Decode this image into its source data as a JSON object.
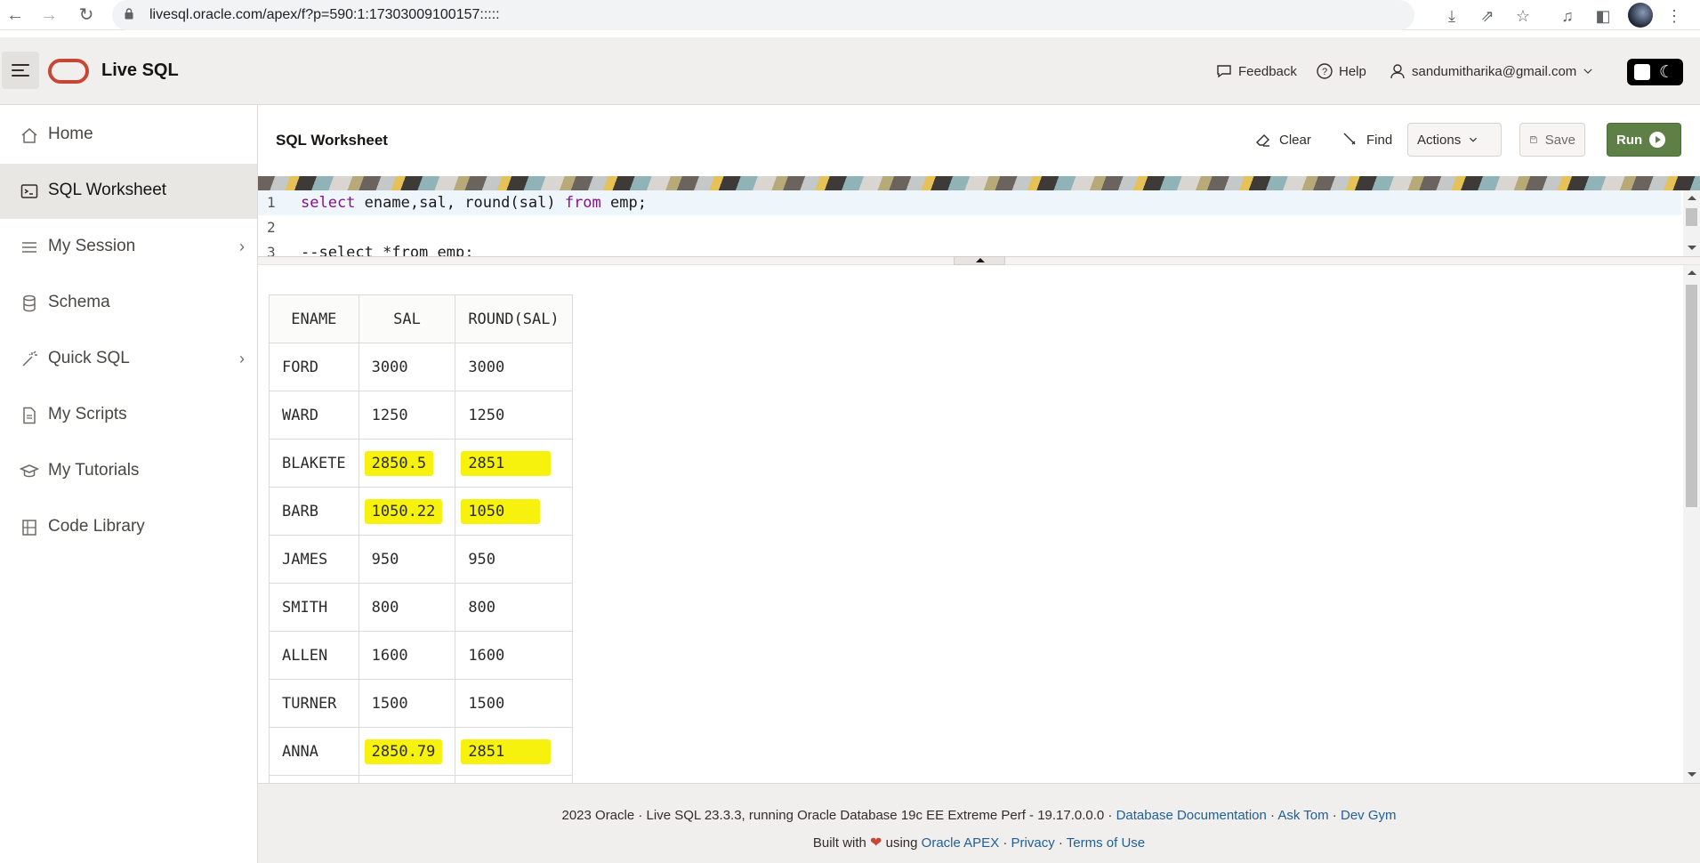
{
  "browser": {
    "url": "livesql.oracle.com/apex/f?p=590:1:17303009100157:::::"
  },
  "header": {
    "app_title": "Live SQL",
    "feedback": "Feedback",
    "help": "Help",
    "user_email": "sandumitharika@gmail.com"
  },
  "sidebar": {
    "items": [
      {
        "label": "Home",
        "icon": "home-icon"
      },
      {
        "label": "SQL Worksheet",
        "icon": "terminal-icon",
        "active": true
      },
      {
        "label": "My Session",
        "icon": "list-icon",
        "has_submenu": true
      },
      {
        "label": "Schema",
        "icon": "database-icon"
      },
      {
        "label": "Quick SQL",
        "icon": "wand-icon",
        "has_submenu": true
      },
      {
        "label": "My Scripts",
        "icon": "file-icon"
      },
      {
        "label": "My Tutorials",
        "icon": "graduation-cap-icon"
      },
      {
        "label": "Code Library",
        "icon": "library-icon"
      }
    ]
  },
  "worksheet": {
    "title": "SQL Worksheet",
    "clear": "Clear",
    "find": "Find",
    "actions": "Actions",
    "save": "Save",
    "run": "Run"
  },
  "editor": {
    "lines": [
      {
        "num": "1",
        "kw1": "select",
        "mid": " ename,sal, round(sal) ",
        "kw2": "from",
        "tail": " emp;"
      },
      {
        "num": "2",
        "text": ""
      },
      {
        "num": "3",
        "text": "--select *from emp;"
      }
    ]
  },
  "results": {
    "columns": [
      "ENAME",
      "SAL",
      "ROUND(SAL)"
    ],
    "rows": [
      [
        "FORD",
        "3000",
        "3000"
      ],
      [
        "WARD",
        "1250",
        "1250"
      ],
      [
        "BLAKETE",
        "2850.5",
        "2851"
      ],
      [
        "BARB",
        "1050.22",
        "1050"
      ],
      [
        "JAMES",
        "950",
        "950"
      ],
      [
        "SMITH",
        "800",
        "800"
      ],
      [
        "ALLEN",
        "1600",
        "1600"
      ],
      [
        "TURNER",
        "1500",
        "1500"
      ],
      [
        "ANNA",
        "2850.79",
        "2851"
      ]
    ],
    "highlighted_rows": [
      2,
      3,
      8
    ],
    "highlight_color": "#f7f20d"
  },
  "footer": {
    "line1_prefix": "2023 Oracle · Live SQL 23.3.3, running Oracle Database 19c EE Extreme Perf - 19.17.0.0.0 · ",
    "db_docs": "Database Documentation",
    "sep1": " · ",
    "ask_tom": "Ask Tom",
    "sep2": " · ",
    "dev_gym": "Dev Gym",
    "built_with": "Built with ",
    "using": " using ",
    "apex": "Oracle APEX",
    "sep3": " · ",
    "privacy": "Privacy",
    "sep4": " · ",
    "terms": "Terms of Use"
  },
  "colors": {
    "oracle_red": "#c74634",
    "run_green": "#5e7f45",
    "link_blue": "#1f5f96"
  }
}
